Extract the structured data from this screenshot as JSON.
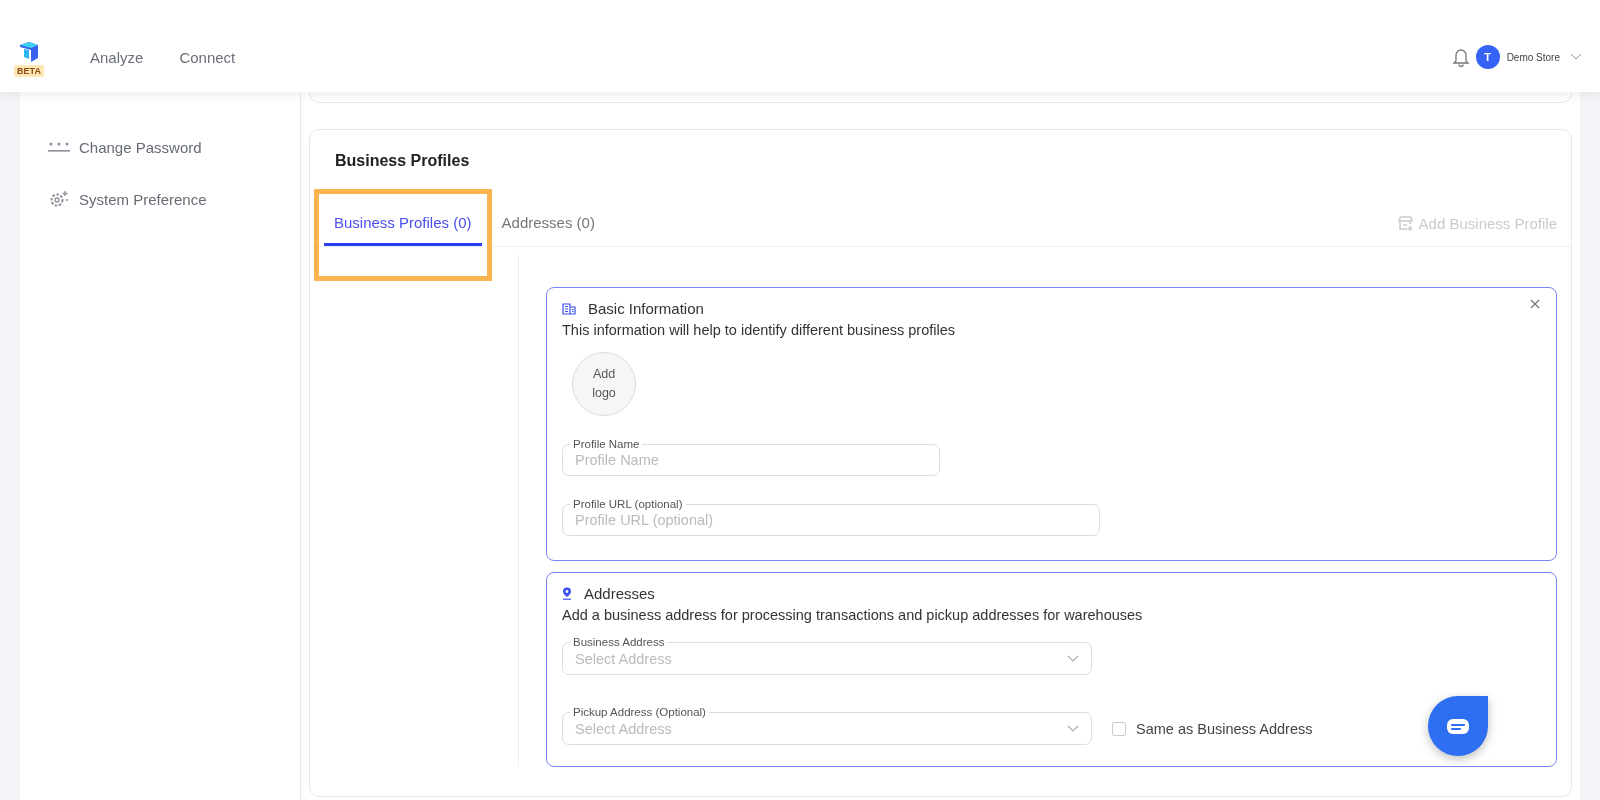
{
  "header": {
    "badge": "BETA",
    "nav": [
      {
        "label": "Analyze"
      },
      {
        "label": "Connect"
      }
    ],
    "avatar_initial": "T",
    "account": "Demo Store"
  },
  "sidebar": {
    "items": [
      {
        "kind": "password",
        "label": "Change Password"
      },
      {
        "kind": "gear",
        "label": "System Preference"
      }
    ]
  },
  "card": {
    "title": "Business Profiles",
    "tabs": [
      {
        "label": "Business Profiles (0)",
        "selected": true
      },
      {
        "label": "Addresses (0)",
        "selected": false
      }
    ],
    "action": {
      "label": "Add Business Profile",
      "disabled": true
    },
    "sections": [
      {
        "kind": "basic",
        "title": "Basic Information",
        "description": "This information will help to identify different business profiles",
        "logo_label": "Add logo",
        "fields": [
          {
            "kind": "text",
            "label": "Profile Name",
            "placeholder": "Profile Name"
          },
          {
            "kind": "text",
            "label": "Profile URL (optional)",
            "placeholder": "Profile URL (optional)"
          }
        ]
      },
      {
        "kind": "addresses",
        "title": "Addresses",
        "description": "Add a business address for processing transactions and pickup addresses for warehouses",
        "fields": [
          {
            "kind": "select",
            "label": "Business Address",
            "placeholder": "Select Address"
          },
          {
            "kind": "select",
            "label": "Pickup Address (Optional)",
            "placeholder": "Select Address",
            "checkbox": {
              "label": "Same as Business Address",
              "checked": false
            }
          }
        ]
      }
    ]
  }
}
